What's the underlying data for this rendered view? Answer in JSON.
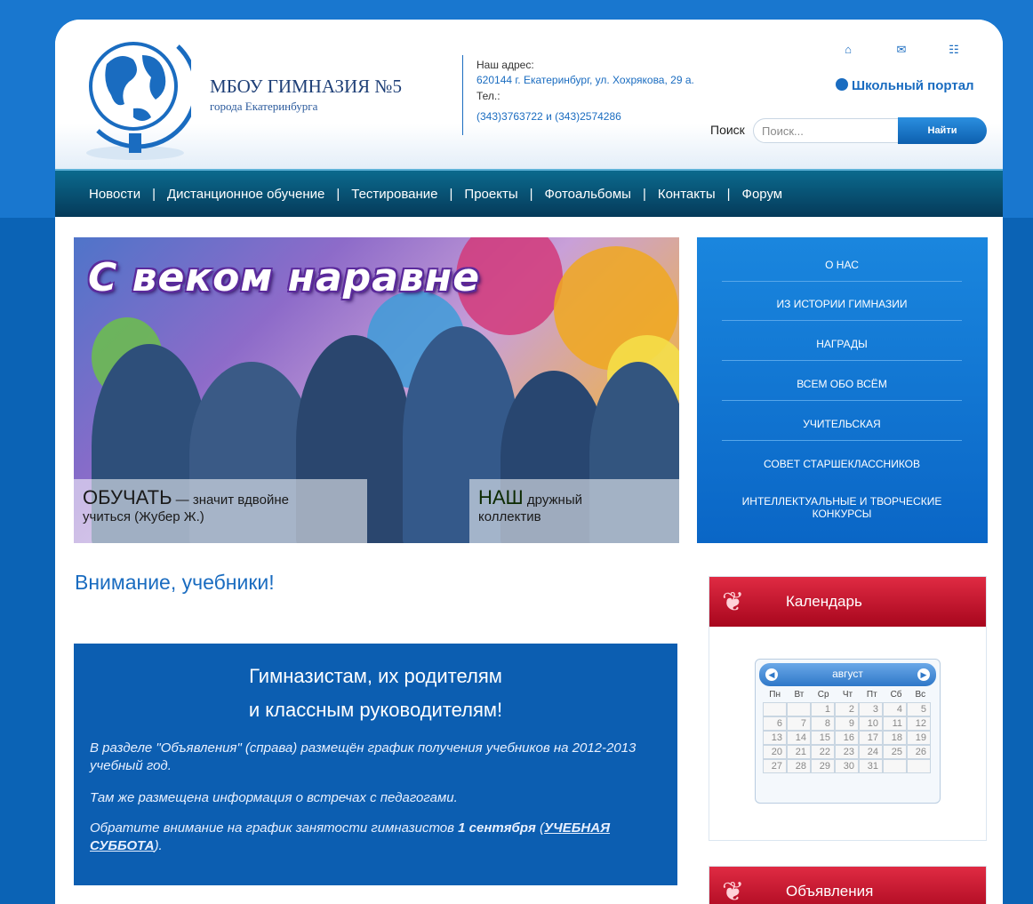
{
  "header": {
    "school_name": "МБОУ ГИМНАЗИЯ №5",
    "school_city": "города Екатеринбурга",
    "address_label": "Наш адрес:",
    "address": "620144 г. Екатеринбург, ул. Хохрякова, 29 а.",
    "phone_label": "Тел.:",
    "phones": "(343)3763722 и (343)2574286",
    "icons": [
      "home-icon",
      "mail-icon",
      "sitemap-icon"
    ],
    "portal_link": "Школьный портал",
    "search": {
      "label": "Поиск",
      "placeholder": "Поиск...",
      "button": "Найти"
    }
  },
  "nav": {
    "items": [
      "Новости",
      "Дистанционное обучение",
      "Тестирование",
      "Проекты",
      "Фотоальбомы",
      "Контакты",
      "Форум"
    ],
    "separator": "|"
  },
  "banner": {
    "title": "С веком наравне",
    "caption1_big": "ОБУЧАТЬ",
    "caption1_rest": " — значит вдвойне",
    "caption1_line2": "учиться (Жубер Ж.)",
    "caption2_big": "НАШ",
    "caption2_rest": " дружный",
    "caption2_line2": "коллектив"
  },
  "side_menu": {
    "items": [
      "О НАС",
      "ИЗ ИСТОРИИ ГИМНАЗИИ",
      "НАГРАДЫ",
      "ВСЕМ ОБО ВСЁМ",
      "УЧИТЕЛЬСКАЯ",
      "СОВЕТ СТАРШЕКЛАССНИКОВ",
      "ИНТЕЛЛЕКТУАЛЬНЫЕ И ТВОРЧЕСКИЕ КОНКУРСЫ"
    ]
  },
  "article": {
    "title": "Внимание, учебники!",
    "notice_heading_1": "Гимназистам, их родителям",
    "notice_heading_2": "и классным руководителям!",
    "p1": "В разделе \"Объявления\" (справа) размещён график получения учебников на 2012-2013 учебный год.",
    "p2": "Там же размещена информация о встречах с педагогами.",
    "p3_start": "Обратите внимание на график занятости гимназистов ",
    "p3_bold": "1 сентября",
    "p3_open": " (",
    "p3_link": "УЧЕБНАЯ СУББОТА",
    "p3_end": ")."
  },
  "calendar_widget": {
    "title": "Календарь",
    "month": "август",
    "dows": [
      "Пн",
      "Вт",
      "Ср",
      "Чт",
      "Пт",
      "Сб",
      "Вс"
    ],
    "weeks": [
      [
        "",
        "",
        "1",
        "2",
        "3",
        "4",
        "5"
      ],
      [
        "6",
        "7",
        "8",
        "9",
        "10",
        "11",
        "12"
      ],
      [
        "13",
        "14",
        "15",
        "16",
        "17",
        "18",
        "19"
      ],
      [
        "20",
        "21",
        "22",
        "23",
        "24",
        "25",
        "26"
      ],
      [
        "27",
        "28",
        "29",
        "30",
        "31",
        "",
        ""
      ]
    ]
  },
  "announcements_widget": {
    "title": "Объявления"
  },
  "colors": {
    "page_bg": "#0b63b5",
    "accent_blue": "#1a6cc0",
    "nav_dark": "#053a5a",
    "widget_red": "#c8102e"
  }
}
